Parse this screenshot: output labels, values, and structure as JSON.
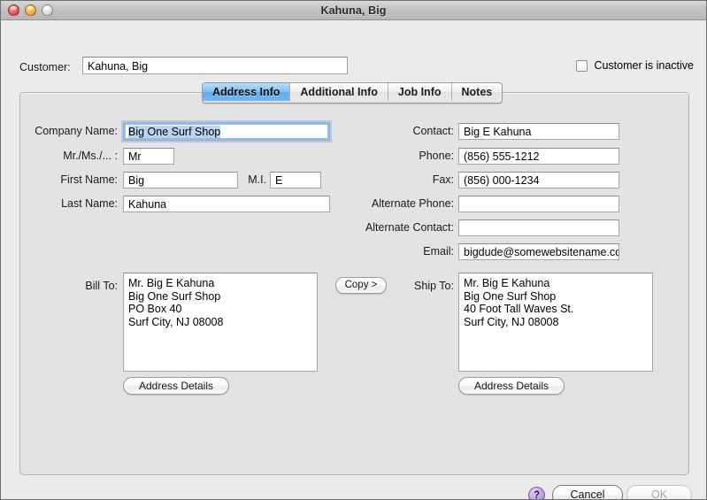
{
  "window": {
    "title": "Kahuna, Big",
    "traffic_lights": [
      "close",
      "minimize",
      "zoom"
    ]
  },
  "header": {
    "customer_label": "Customer:",
    "customer_value": "Kahuna, Big",
    "inactive_checkbox_label": "Customer is inactive",
    "inactive_checked": false
  },
  "tabs": [
    {
      "label": "Address Info",
      "active": true
    },
    {
      "label": "Additional Info",
      "active": false
    },
    {
      "label": "Job Info",
      "active": false
    },
    {
      "label": "Notes",
      "active": false
    }
  ],
  "left_fields": {
    "company_label": "Company Name:",
    "company_value": "Big One Surf Shop",
    "salutation_label": "Mr./Ms./... :",
    "salutation_value": "Mr",
    "first_label": "First Name:",
    "first_value": "Big",
    "mi_label": "M.I. :",
    "mi_value": "E",
    "last_label": "Last Name:",
    "last_value": "Kahuna"
  },
  "right_fields": {
    "contact_label": "Contact:",
    "contact_value": "Big E Kahuna",
    "phone_label": "Phone:",
    "phone_value": "(856) 555-1212",
    "fax_label": "Fax:",
    "fax_value": "(856) 000-1234",
    "alt_phone_label": "Alternate Phone:",
    "alt_phone_value": "",
    "alt_contact_label": "Alternate Contact:",
    "alt_contact_value": "",
    "email_label": "Email:",
    "email_value": "bigdude@somewebsitename.com"
  },
  "addresses": {
    "bill_to_label": "Bill To:",
    "bill_to_value": "Mr. Big E Kahuna\nBig One Surf Shop\nPO Box 40\nSurf City, NJ 08008",
    "ship_to_label": "Ship To:",
    "ship_to_value": "Mr. Big E Kahuna\nBig One Surf Shop\n40 Foot Tall Waves St.\nSurf City, NJ 08008",
    "copy_label": "Copy >",
    "address_details_label": "Address Details"
  },
  "footer": {
    "help_label": "?",
    "cancel_label": "Cancel",
    "ok_label": "OK",
    "ok_enabled": false
  },
  "colors": {
    "accent_tab": "#5fa9ef",
    "focus_ring": "#8cb4e1",
    "selection": "#b9d4ec",
    "window_bg": "#ebebeb",
    "panel_bg": "#e3e3e3",
    "help_purple": "#b89ad8"
  }
}
